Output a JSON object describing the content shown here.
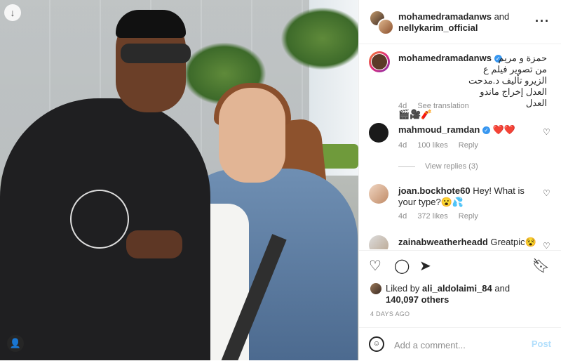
{
  "header": {
    "user1": "mohamedramadanws",
    "and": "and",
    "user2": "nellykarim_official",
    "more_icon": "more-horizontal-icon"
  },
  "caption": {
    "username": "mohamedramadanws",
    "text": "حمزة و مريم\nمن تصوير فيلم ع الزيرو تأليف د.مدحت\nالعدل إخراج ماندو العدل",
    "emojis": "🎬🎥🧨",
    "age": "4d",
    "see_translation": "See translation"
  },
  "comments": [
    {
      "username": "mahmoud_ramdan",
      "text": "❤️❤️",
      "age": "4d",
      "likes": "100 likes",
      "reply": "Reply"
    },
    {
      "username": "joan.bockhote60",
      "text": "Hey! What is your type?😮💦",
      "age": "4d",
      "likes": "372 likes",
      "reply": "Reply"
    },
    {
      "username": "zainabweatherheadd",
      "text": "Greatpic😵"
    }
  ],
  "view_replies": "View replies (3)",
  "likes": {
    "prefix": "Liked by",
    "user": "ali_aldolaimi_84",
    "and": "and",
    "count": "140,097 others"
  },
  "timestamp": "4 DAYS AGO",
  "add_comment": {
    "placeholder": "Add a comment...",
    "post_label": "Post"
  },
  "icons": {
    "like": "heart-icon",
    "comment": "comment-icon",
    "share": "share-icon",
    "save": "bookmark-icon",
    "emoji": "emoji-icon",
    "download": "download-icon",
    "tags": "user-tag-icon"
  },
  "colors": {
    "accent": "#3897f0",
    "heart": "#ed4956",
    "muted": "#8e8e8e",
    "post_disabled": "#b2dffc"
  }
}
